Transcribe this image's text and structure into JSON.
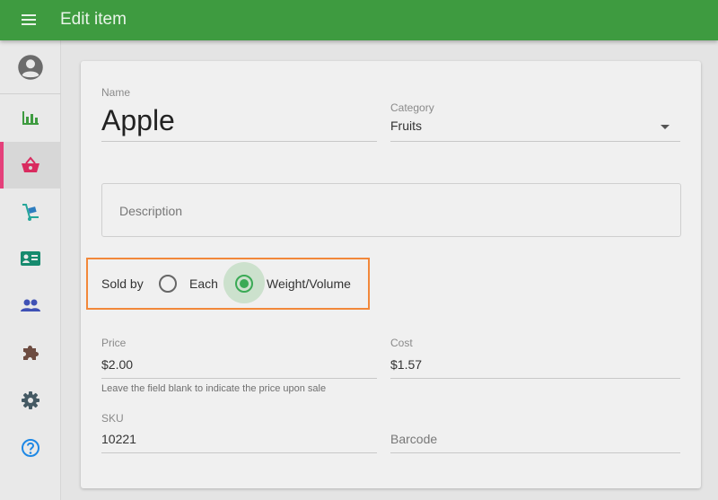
{
  "header": {
    "title": "Edit item"
  },
  "sidebar": {
    "items": [
      {
        "name": "reports",
        "icon": "bar-chart-icon",
        "color": "#3e9b40"
      },
      {
        "name": "items",
        "icon": "basket-icon",
        "color": "#d92b5f",
        "active": true
      },
      {
        "name": "inventory",
        "icon": "hand-truck-icon",
        "color": "#26a69a"
      },
      {
        "name": "employees",
        "icon": "id-card-icon",
        "color": "#168a6e"
      },
      {
        "name": "customers",
        "icon": "people-icon",
        "color": "#3f51b5"
      },
      {
        "name": "integrations",
        "icon": "puzzle-icon",
        "color": "#6d4c41"
      },
      {
        "name": "settings",
        "icon": "gear-icon",
        "color": "#455a64"
      },
      {
        "name": "help",
        "icon": "help-icon",
        "color": "#1e88e5"
      }
    ]
  },
  "form": {
    "name_label": "Name",
    "name_value": "Apple",
    "category_label": "Category",
    "category_value": "Fruits",
    "description_placeholder": "Description",
    "sold_by_label": "Sold by",
    "option_each": "Each",
    "option_weight": "Weight/Volume",
    "selected_option": "Weight/Volume",
    "price_label": "Price",
    "price_value": "$2.00",
    "price_helper": "Leave the field blank to indicate the price upon sale",
    "cost_label": "Cost",
    "cost_value": "$1.57",
    "sku_label": "SKU",
    "sku_value": "10221",
    "barcode_placeholder": "Barcode"
  },
  "colors": {
    "header": "#3e9b40",
    "accent": "#3aaa55",
    "highlight": "#f2883a",
    "active_indicator": "#e4407a"
  }
}
